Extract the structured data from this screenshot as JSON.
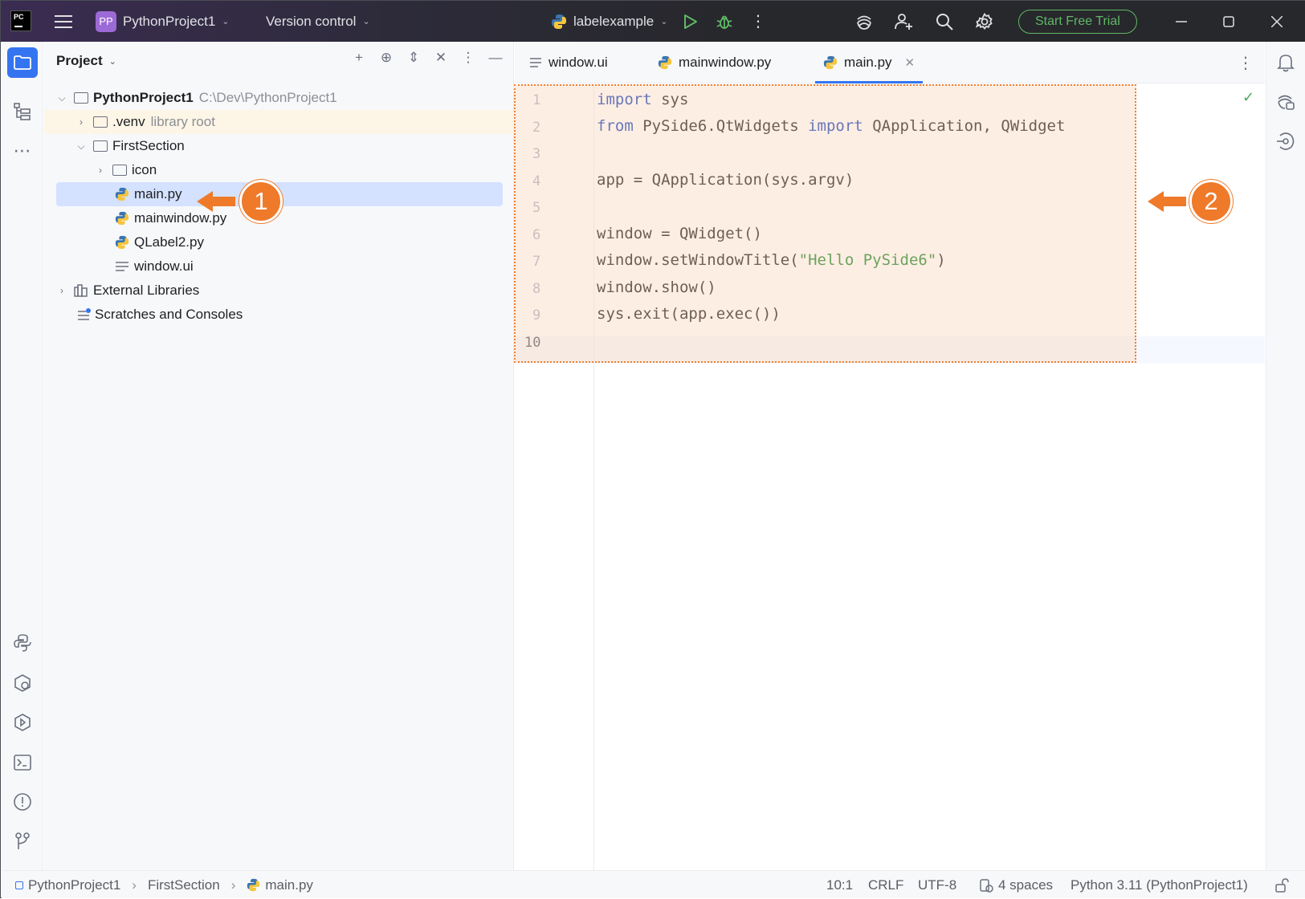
{
  "titlebar": {
    "project_badge": "PP",
    "project_name": "PythonProject1",
    "vcs_label": "Version control",
    "run_config": "labelexample",
    "trial_button": "Start Free Trial"
  },
  "project_panel": {
    "title": "Project",
    "tree": [
      {
        "label": "PythonProject1",
        "hint": "C:\\Dev\\PythonProject1"
      },
      {
        "label": ".venv",
        "hint": "library root"
      },
      {
        "label": "FirstSection"
      },
      {
        "label": "icon"
      },
      {
        "label": "main.py"
      },
      {
        "label": "mainwindow.py"
      },
      {
        "label": "QLabel2.py"
      },
      {
        "label": "window.ui"
      },
      {
        "label": "External Libraries"
      },
      {
        "label": "Scratches and Consoles"
      }
    ]
  },
  "editor": {
    "tabs": [
      {
        "label": "window.ui"
      },
      {
        "label": "mainwindow.py"
      },
      {
        "label": "main.py"
      }
    ],
    "line_numbers": [
      "1",
      "2",
      "3",
      "4",
      "5",
      "6",
      "7",
      "8",
      "9",
      "10"
    ],
    "code": {
      "l1_kw": "import",
      "l1_rest": " sys",
      "l2_kw1": "from",
      "l2_mid": " PySide6.QtWidgets ",
      "l2_kw2": "import",
      "l2_rest": " QApplication, QWidget",
      "l4": "app = QApplication(sys.argv)",
      "l6": "window = QWidget()",
      "l7_a": "window.setWindowTitle(",
      "l7_str": "\"Hello PySide6\"",
      "l7_b": ")",
      "l8": "window.show()",
      "l9": "sys.exit(app.exec())"
    }
  },
  "callouts": {
    "one": "1",
    "two": "2"
  },
  "statusbar": {
    "crumbs": [
      "PythonProject1",
      "FirstSection",
      "main.py"
    ],
    "position": "10:1",
    "line_ending": "CRLF",
    "encoding": "UTF-8",
    "indent": "4 spaces",
    "interpreter": "Python 3.11 (PythonProject1)"
  },
  "colors": {
    "accent": "#3574f0",
    "callout": "#ee7a2a",
    "keyword": "#0033b3",
    "string": "#067d17",
    "trial": "#5fb865"
  }
}
